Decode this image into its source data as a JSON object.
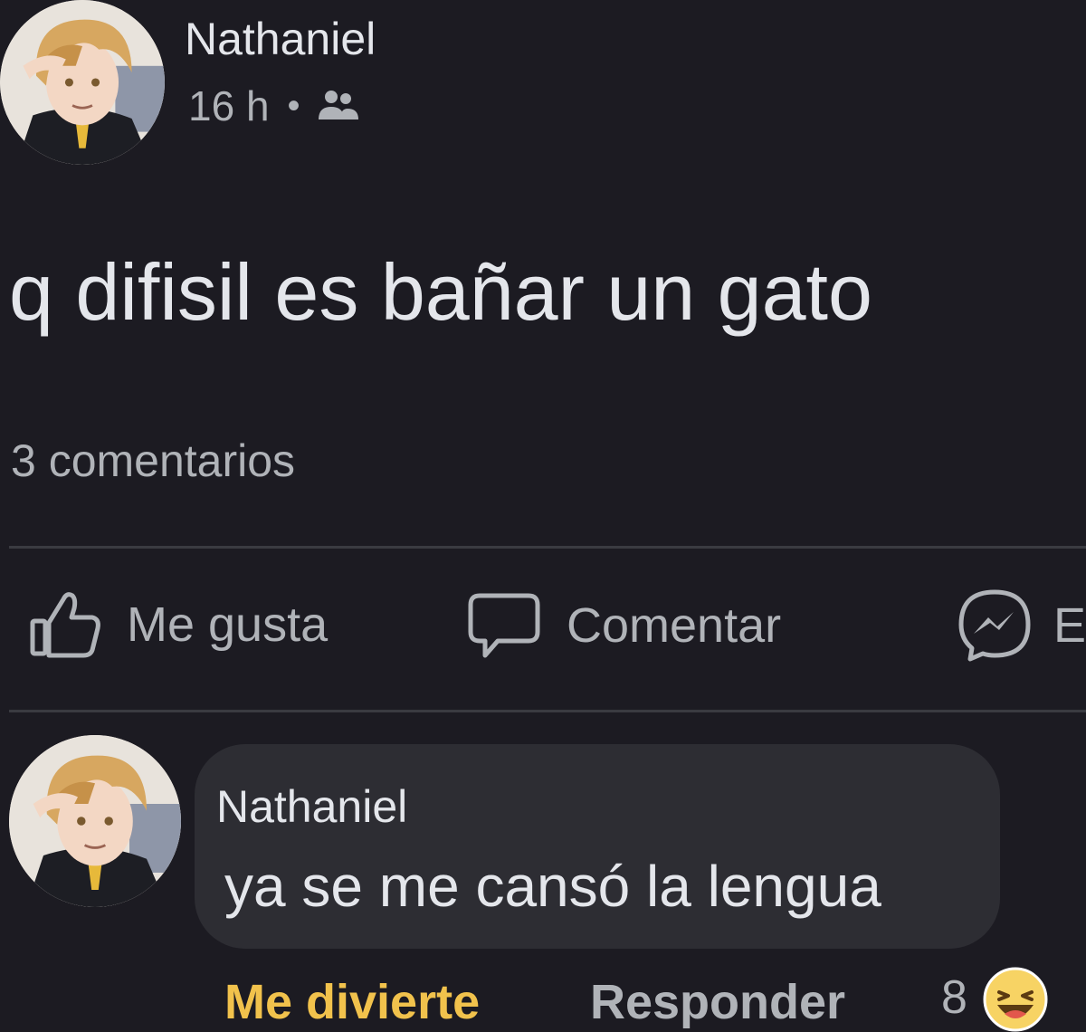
{
  "post": {
    "author": "Nathaniel",
    "time": "16 h",
    "separator": "•",
    "audience_icon": "friends-icon",
    "text": "q difisil es bañar un gato",
    "comment_count": "3 comentarios"
  },
  "actions": {
    "like": "Me gusta",
    "comment": "Comentar",
    "send": "E"
  },
  "comment": {
    "author": "Nathaniel",
    "text": "ya se me cansó la lengua",
    "reaction_label": "Me divierte",
    "reply_label": "Responder",
    "reaction_count": "8",
    "reaction_icon": "haha-emoji-icon"
  },
  "colors": {
    "background": "#1c1b22",
    "bubble": "#2d2d33",
    "text_primary": "#e4e6eb",
    "text_secondary": "#b0b3b8",
    "haha_accent": "#f1c24c"
  }
}
